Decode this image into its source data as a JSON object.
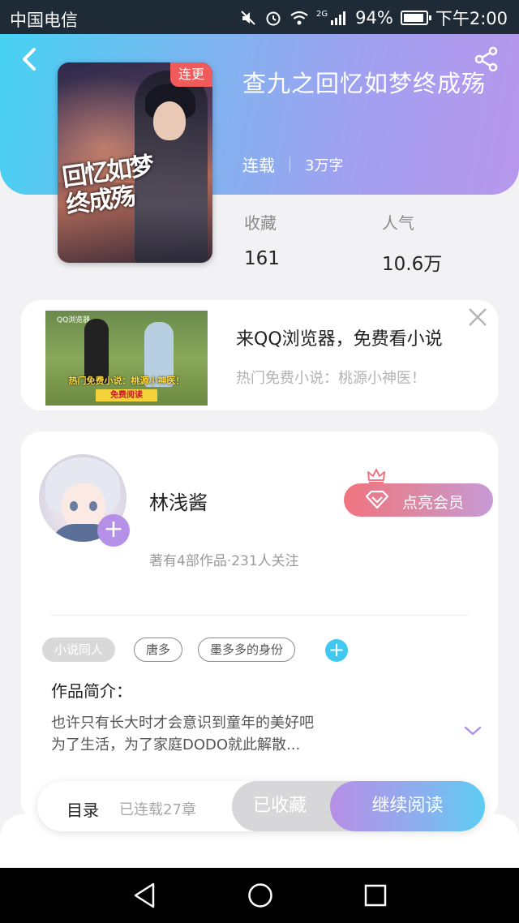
{
  "status_bar": {
    "carrier": "中国电信",
    "network": "2G",
    "battery": "94%",
    "time": "下午2:00"
  },
  "book": {
    "title": "查九之回忆如梦终成殇",
    "status": "连载",
    "word_count": "3万字",
    "cover_badge": "连更",
    "cover_art_text": "回忆如梦终成殇",
    "stats": [
      {
        "label": "收藏",
        "value": "161"
      },
      {
        "label": "人气",
        "value": "10.6万"
      }
    ]
  },
  "ad": {
    "title": "来QQ浏览器，免费看小说",
    "subtitle": "热门免费小说：桃源小神医！",
    "thumb_logo": "QQ浏览器",
    "thumb_caption": "热门免费小说：桃源小神医！",
    "thumb_button": "免费阅读"
  },
  "author": {
    "name": "林浅酱",
    "stats": "著有4部作品·231人关注",
    "vip_button": "点亮会员"
  },
  "tags": [
    "小说同人",
    "唐多",
    "墨多多的身份"
  ],
  "intro": {
    "label": "作品简介：",
    "line1": "也许只有长大时才会意识到童年的美好吧",
    "line2": "为了生活，为了家庭DODO就此解散..."
  },
  "bottom_bar": {
    "toc_label": "目录",
    "toc_count": "已连载27章",
    "collected_label": "已收藏",
    "continue_label": "继续阅读"
  },
  "colors": {
    "header_start": "#46d2f3",
    "header_end": "#b897ec",
    "badge_red": "#ef5b5b",
    "accent_purple": "#b490e6",
    "accent_blue": "#3fc9f0"
  },
  "icons": [
    "back-arrow-icon",
    "share-icon",
    "close-icon",
    "plus-icon",
    "diamond-icon",
    "crown-icon",
    "chevron-down-icon",
    "nav-back-icon",
    "nav-home-icon",
    "nav-recents-icon"
  ]
}
